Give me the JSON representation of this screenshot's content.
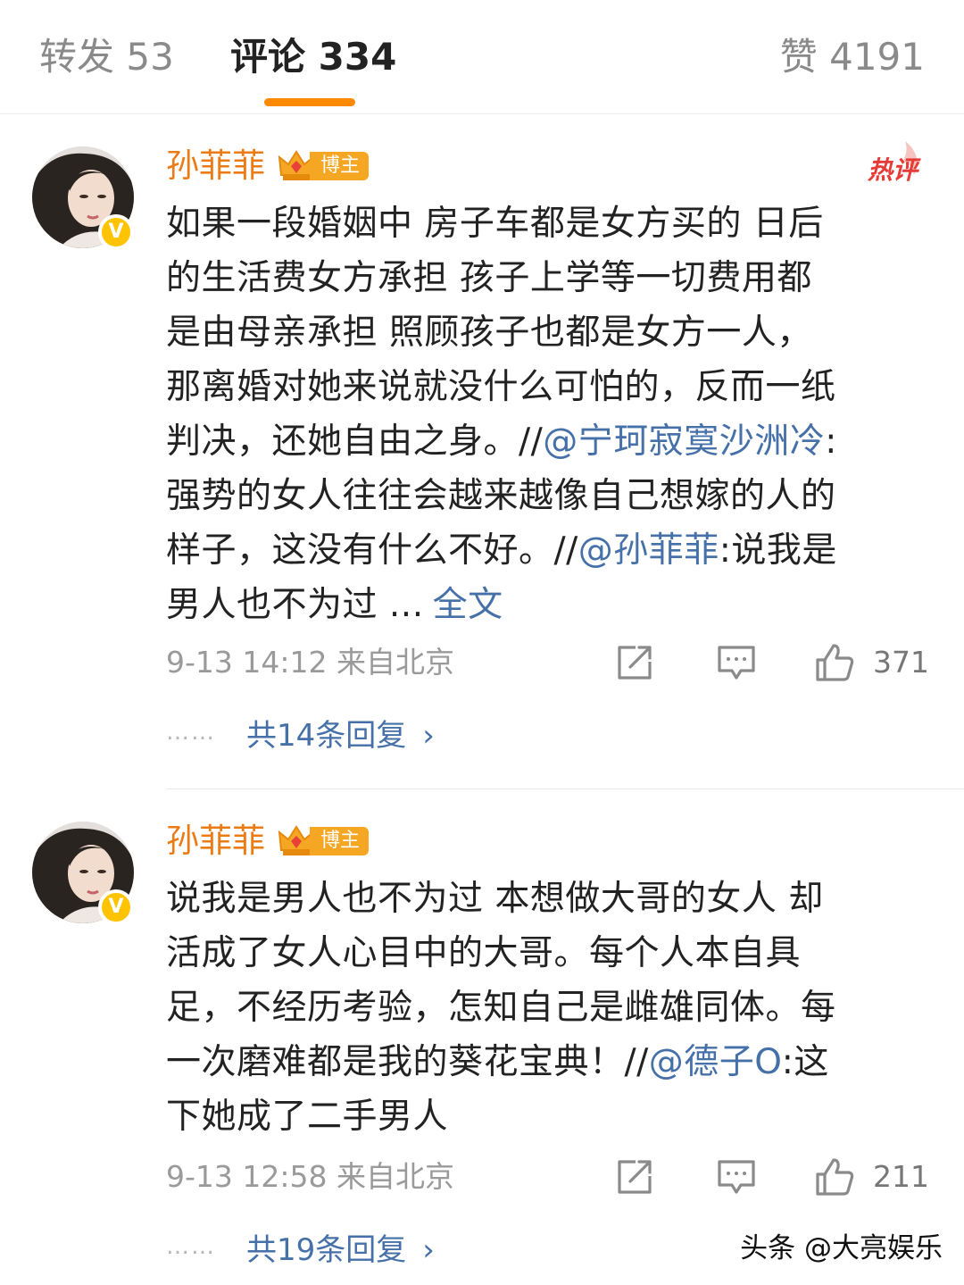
{
  "tabs": {
    "repost": "转发 53",
    "comments": "评论 334",
    "likes": "赞 4191"
  },
  "colors": {
    "accent": "#ff8a00",
    "username": "#eb7b14",
    "link": "#4670a8",
    "hot": "#e63b37"
  },
  "comments": [
    {
      "user": "孙菲菲",
      "badge": "博主",
      "hot_label": "热评",
      "body": {
        "line1": "如果一段婚姻中 房子车都是女方买的 日后",
        "line2": "的生活费女方承担  孩子上学等一切费用都",
        "line3": "是由母亲承担  照顾孩子也都是女方一人，",
        "line4": "那离婚对她来说就没什么可怕的，反而一纸",
        "line5a": "判决，还她自由之身。//",
        "mention1": "@宁珂寂寞沙洲冷",
        "line5b": ":",
        "line6": "强势的女人往往会越来越像自己想嫁的人的",
        "line7a": "样子，这没有什么不好。//",
        "mention2": "@孙菲菲",
        "line7b": ":说我是",
        "line8": "男人也不为过 ...",
        "fulltext": "全文"
      },
      "time": "9-13 14:12",
      "location": "来自北京",
      "likes": "371",
      "dots": "……",
      "replies": "共14条回复"
    },
    {
      "user": "孙菲菲",
      "badge": "博主",
      "body": {
        "line1": "说我是男人也不为过 本想做大哥的女人 却",
        "line2": "活成了女人心目中的大哥。每个人本自具",
        "line3": "足，不经历考验，怎知自己是雌雄同体。每",
        "line4a": "一次磨难都是我的葵花宝典！//",
        "mention1": "@德子O",
        "line4b": ":这",
        "line5": "下她成了二手男人"
      },
      "time": "9-13 12:58",
      "location": "来自北京",
      "likes": "211",
      "dots": "……",
      "replies": "共19条回复"
    }
  ],
  "icons": {
    "share": "share-icon",
    "comment": "comment-icon",
    "like": "thumbs-up-icon",
    "chevron": "chevron-right-icon",
    "verified": "verified-badge-icon",
    "crown": "crown-icon"
  },
  "watermark": "头条 @大亮娱乐"
}
